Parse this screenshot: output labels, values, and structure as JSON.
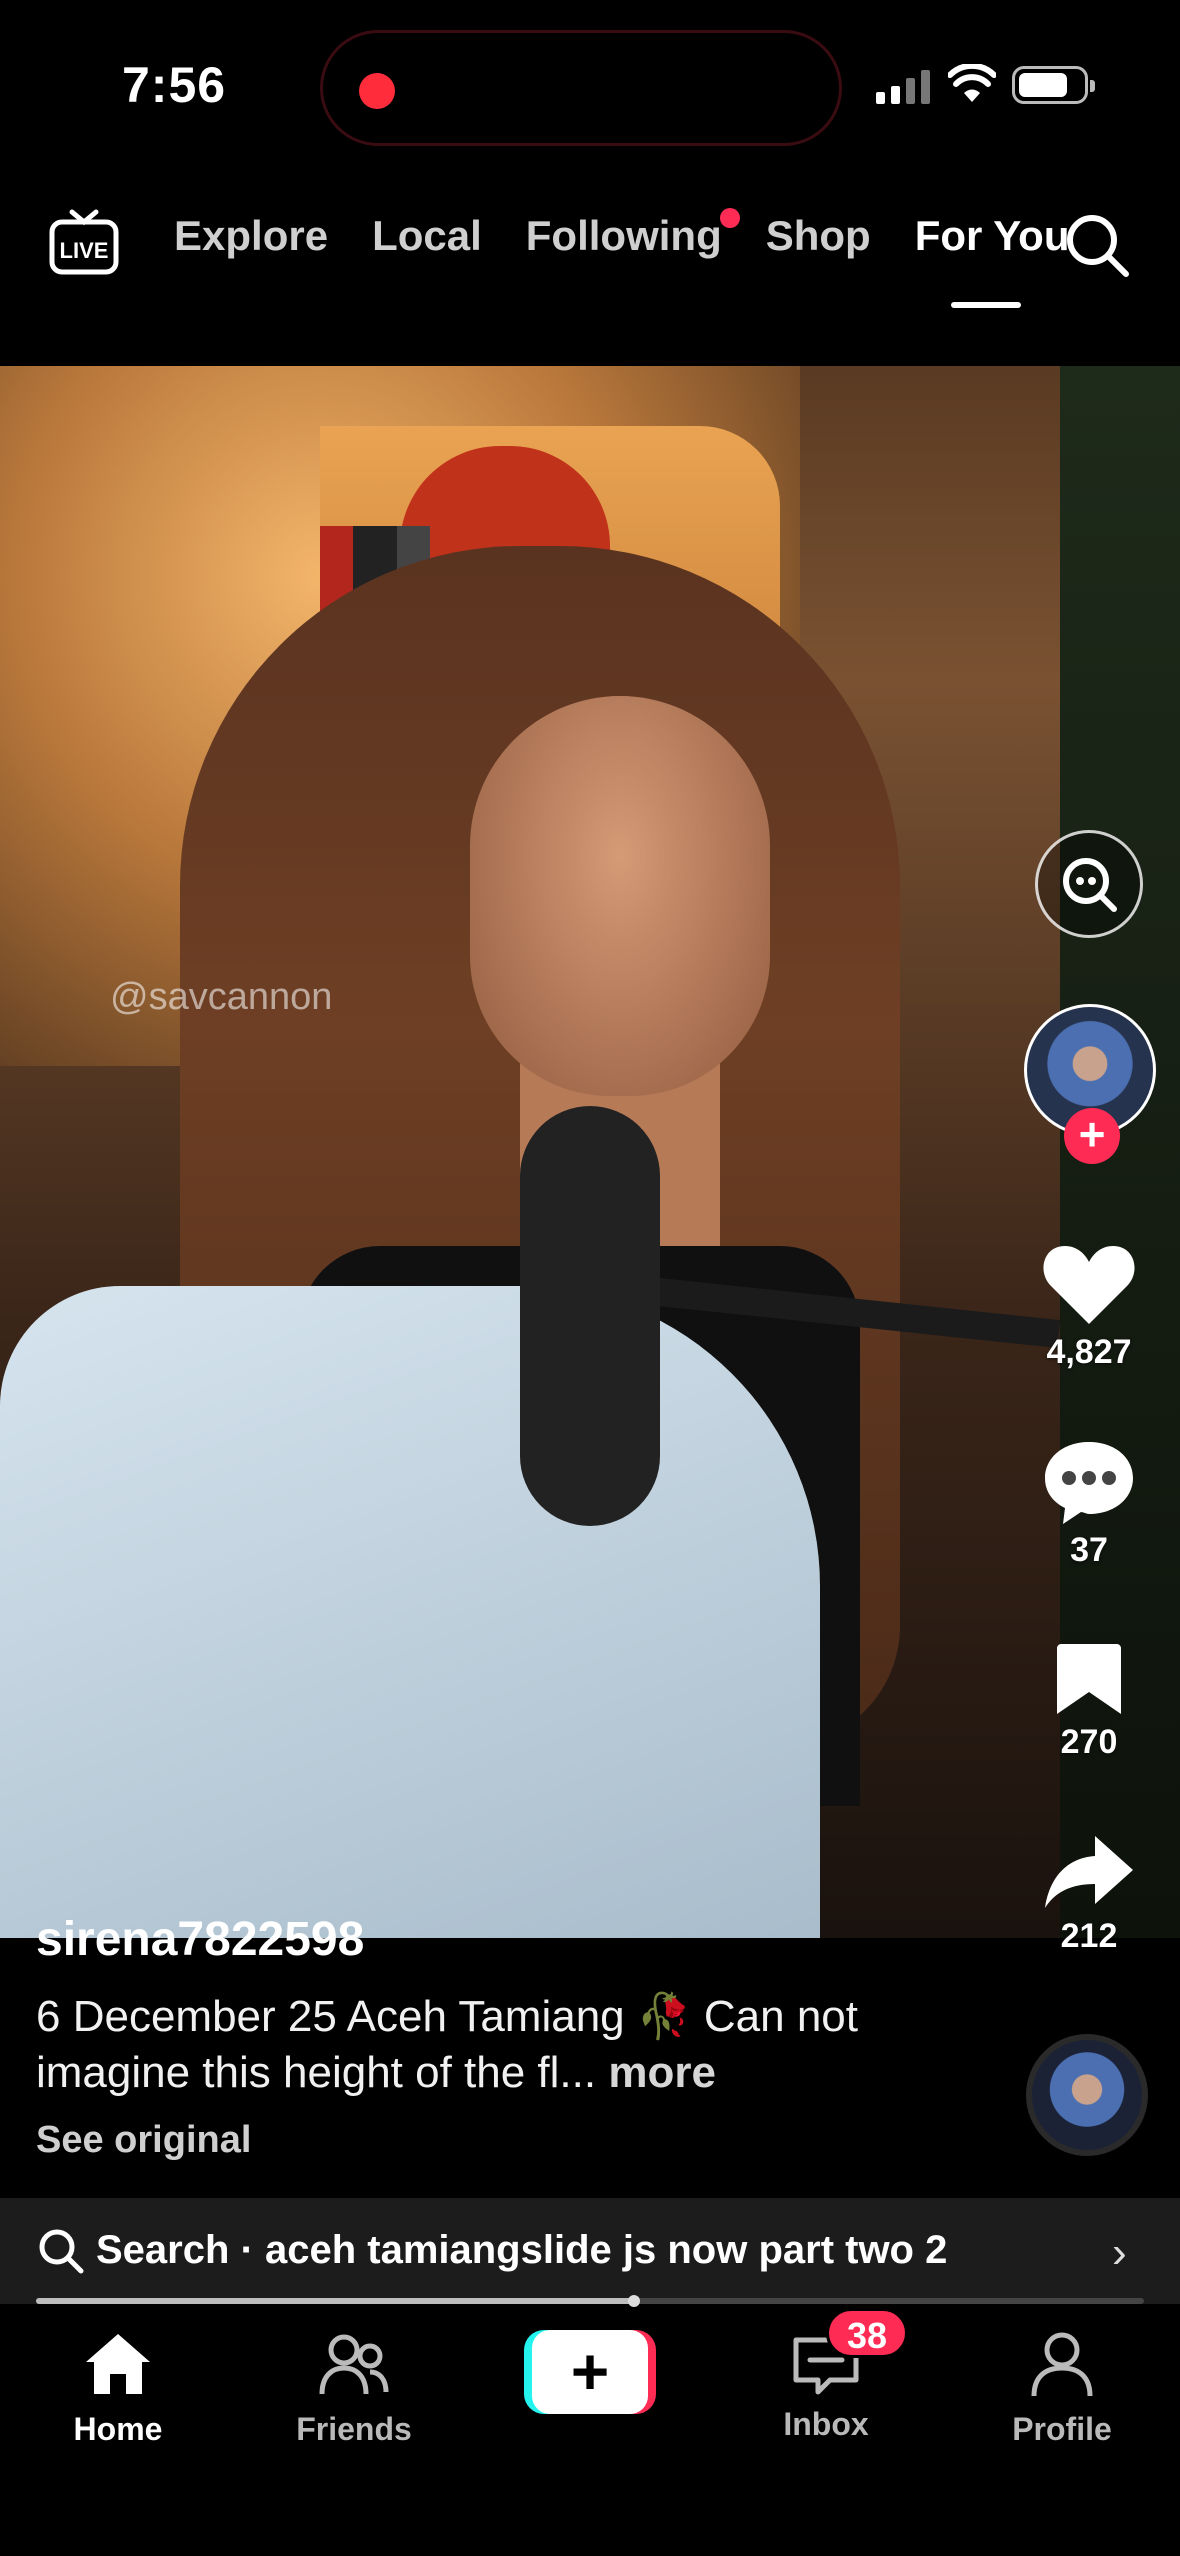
{
  "status_bar": {
    "time": "7:56",
    "recording_indicator_color": "#ff2d3c"
  },
  "top_nav": {
    "live_label": "LIVE",
    "tabs": [
      {
        "label": "Explore",
        "active": false
      },
      {
        "label": "Local",
        "active": false
      },
      {
        "label": "Following",
        "active": false,
        "has_dot": true
      },
      {
        "label": "Shop",
        "active": false
      },
      {
        "label": "For You",
        "active": true
      }
    ]
  },
  "video": {
    "watermark": "@savcannon"
  },
  "actions": {
    "likes": "4,827",
    "comments": "37",
    "saves": "270",
    "shares": "212"
  },
  "caption": {
    "username": "sirena7822598",
    "description": "6 December 25 Aceh Tamiang 🥀 Can not imagine this height of the fl...",
    "more_label": "more",
    "see_original": "See original"
  },
  "search_suggestion": {
    "text": "Search · aceh tamiangslide js now part two 2"
  },
  "playback_progress": 0.54,
  "bottom_nav": {
    "home": "Home",
    "friends": "Friends",
    "create": "+",
    "inbox": "Inbox",
    "inbox_badge": "38",
    "profile": "Profile"
  },
  "colors": {
    "accent": "#fe2c55",
    "cyan": "#25f4ee",
    "background": "#000000"
  }
}
